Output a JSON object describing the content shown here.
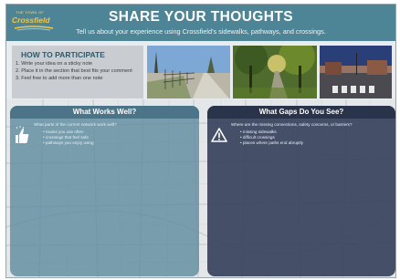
{
  "header": {
    "logo_small": "THE TOWN OF",
    "logo_name": "Crossfield",
    "title": "SHARE YOUR THOUGHTS",
    "subtitle": "Tell us about your experience using Crossfield's sidewalks, pathways, and crossings."
  },
  "how_to": {
    "title": "HOW TO PARTICIPATE",
    "steps": [
      "1. Write your idea on a sticky note",
      "2. Place it in the section that best fits your comment",
      "3. Feel free to add more than one note"
    ]
  },
  "photos": [
    {
      "icon": "sidewalk-photo"
    },
    {
      "icon": "tree-pathway-photo"
    },
    {
      "icon": "street-crossing-photo"
    }
  ],
  "left_panel": {
    "title": "What Works Well?",
    "icon": "thumbs-up-icon",
    "question": "What parts of the current network work well?",
    "bullets": [
      "routes you use often",
      "crossings that feel safe",
      "pathways you enjoy using"
    ],
    "color": "#608ca0"
  },
  "right_panel": {
    "title": "What Gaps Do You See?",
    "icon": "warning-icon",
    "question": "Where are the missing connections, safety concerns, or barriers?",
    "bullets": [
      "missing sidewalks",
      "difficult crossings",
      "places where paths end abruptly"
    ],
    "color": "#37425c"
  },
  "colors": {
    "banner": "#4e8596",
    "logo_gold": "#f4c542"
  }
}
